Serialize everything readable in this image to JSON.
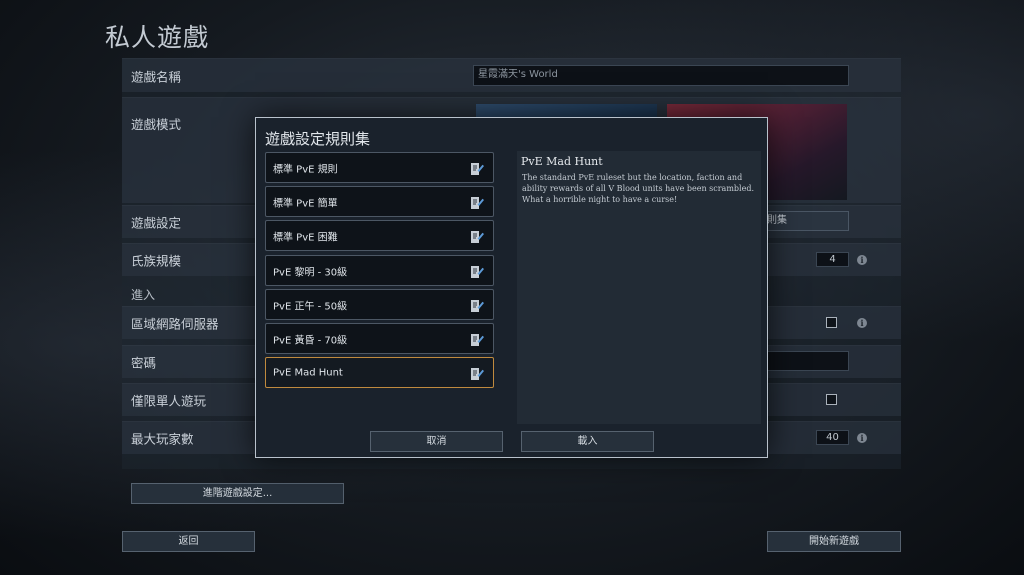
{
  "page": {
    "title": "私人遊戲"
  },
  "settings": {
    "game_name_label": "遊戲名稱",
    "game_name_value": "星霞滿天's World",
    "game_mode_label": "遊戲模式",
    "game_settings_label": "遊戲設定",
    "ruleset_button_partial": "則集",
    "clan_size_label": "氏族規模",
    "clan_size_value": "4",
    "join_section_label": "進入",
    "lan_server_label": "區域網路伺服器",
    "password_label": "密碼",
    "solo_only_label": "僅限單人遊玩",
    "max_players_label": "最大玩家數",
    "max_players_value": "40",
    "advanced_button": "進階遊戲設定...",
    "back_button": "返回",
    "start_button": "開始新遊戲",
    "info_glyph": "i"
  },
  "modal": {
    "title": "遊戲設定規則集",
    "rulesets": [
      {
        "label": "標準 PvE 規則"
      },
      {
        "label": "標準 PvE 簡單"
      },
      {
        "label": "標準 PvE 困難"
      },
      {
        "label": "PvE 黎明 - 30級"
      },
      {
        "label": "PvE 正午 - 50級"
      },
      {
        "label": "PvE 黃昏 - 70級"
      },
      {
        "label": "PvE Mad Hunt",
        "selected": true
      }
    ],
    "detail_title": "PvE Mad Hunt",
    "detail_description": "The standard PvE ruleset but the location, faction and ability rewards of all V Blood units have been scrambled. What a horrible night to have a curse!",
    "cancel_button": "取消",
    "load_button": "載入"
  },
  "colors": {
    "selected_border": "#c08a3e",
    "modal_border": "#b9c2cc",
    "panel_bg": "#2d3744"
  }
}
